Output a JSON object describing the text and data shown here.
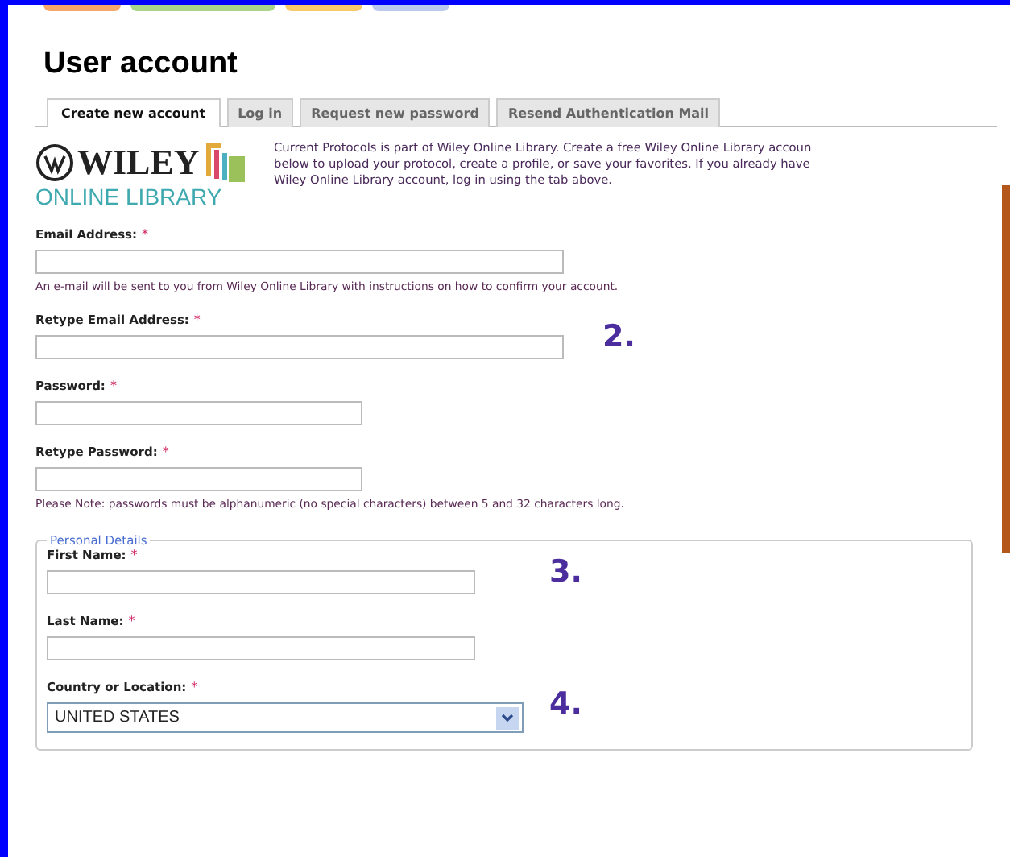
{
  "page": {
    "title": "User account"
  },
  "tabs": [
    {
      "label": "Create new account",
      "selected": true
    },
    {
      "label": "Log in",
      "selected": false
    },
    {
      "label": "Request new password",
      "selected": false
    },
    {
      "label": "Resend Authentication Mail",
      "selected": false
    }
  ],
  "logo": {
    "brand": "WILEY",
    "subtitle": "ONLINE LIBRARY"
  },
  "intro": [
    "Current Protocols is part of Wiley Online Library. Create a free Wiley Online Library accoun",
    "below to upload your protocol, create a profile, or save your favorites. If you already have",
    "Wiley Online Library account, log in using the tab above."
  ],
  "fields": [
    {
      "label": "Email Address:",
      "required_mark": "*",
      "kind": "wide",
      "note": "An e-mail will be sent to you from Wiley Online Library with instructions on how to confirm your account."
    },
    {
      "label": "Retype Email Address:",
      "required_mark": "*",
      "kind": "wide",
      "step": "2."
    },
    {
      "label": "Password:",
      "required_mark": "*",
      "kind": "narrow"
    },
    {
      "label": "Retype Password:",
      "required_mark": "*",
      "kind": "narrow",
      "note": "Please Note: passwords must be alphanumeric (no special characters) between 5 and 32 characters long."
    }
  ],
  "personal_details": {
    "legend": "Personal Details",
    "fields": [
      {
        "label": "First Name:",
        "required_mark": "*",
        "kind": "text",
        "step": "3."
      },
      {
        "label": "Last Name:",
        "required_mark": "*",
        "kind": "text"
      },
      {
        "label": "Country or Location:",
        "required_mark": "*",
        "kind": "select",
        "value": "UNITED STATES",
        "step": "4."
      }
    ]
  }
}
